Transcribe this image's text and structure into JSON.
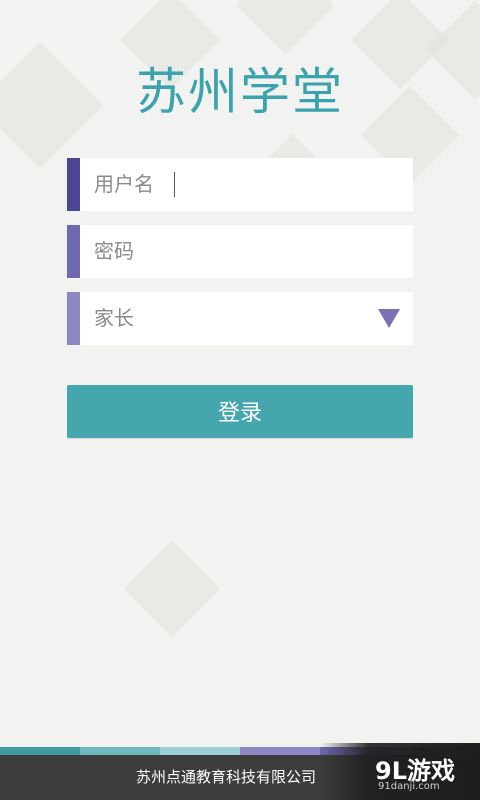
{
  "app": {
    "title": "苏州学堂"
  },
  "form": {
    "username_placeholder": "用户名",
    "password_placeholder": "密码",
    "role_selected": "家长",
    "login_label": "登录"
  },
  "footer": {
    "company": "苏州点通教育科技有限公司"
  },
  "watermark": {
    "brand": "9L游戏",
    "site": "91danji.com"
  },
  "colors": {
    "title": "#3aa3ad",
    "username_stripe": "#4a4694",
    "password_stripe": "#6e68b0",
    "role_stripe": "#8d88c4",
    "button": "#45a6ae",
    "footer_bg": "#3d3d3d"
  },
  "icons": {
    "role_dropdown": "triangle-down-icon"
  }
}
